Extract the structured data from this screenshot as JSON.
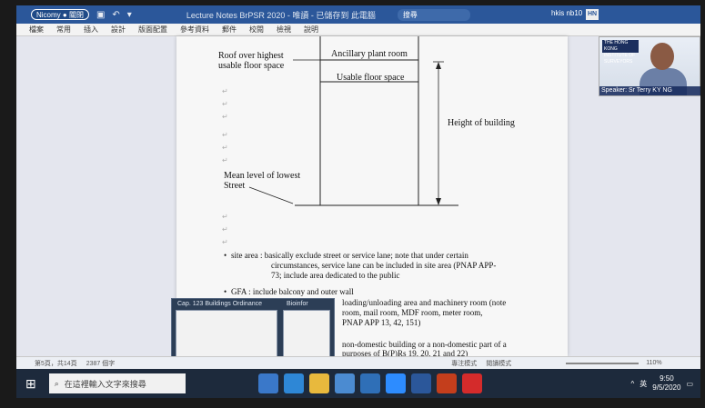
{
  "titlebar": {
    "pill": "Nicomy ● 關閉",
    "title": "Lecture Notes BrPSR 2020 - 唯讀 - 已儲存到 此電腦",
    "search": "搜尋",
    "user": "hkis nb10",
    "avatar": "HN",
    "min": "—",
    "max": "□",
    "close": "✕"
  },
  "ribbon": [
    "檔案",
    "常用",
    "插入",
    "設計",
    "版面配置",
    "參考資料",
    "郵件",
    "校閱",
    "檢視",
    "說明"
  ],
  "diagram": {
    "roof_label_1": "Roof over highest",
    "roof_label_2": "usable floor space",
    "ancillary": "Ancillary plant room",
    "usable": "Usable floor space",
    "height": "Height of building",
    "mean_1": "Mean level of lowest",
    "mean_2": "Street"
  },
  "notes": {
    "site_1": "site area : basically exclude street or service lane; note that under certain",
    "site_2": "circumstances, service lane can be included in site area (PNAP APP-",
    "site_3": "73; include area dedicated to the public",
    "gfa_1": "GFA : include balcony and outer wall",
    "gfa_2": "loading/unloading area and machinery room (note",
    "gfa_3": "room, mail room, MDF room, meter room,",
    "gfa_4": "PNAP APP 13, 42, 151)",
    "nd_1": "non-domestic building or a non-domestic part of a",
    "nd_2": "purposes of B(P)Rs 19, 20, 21 and 22)"
  },
  "video": {
    "logo": "THE HONG KONG INSTITUTE OF SURVEYORS",
    "caption": "Speaker: Sr Terry KY NG"
  },
  "popup": {
    "left_title": "Cap. 123 Buildings Ordinance",
    "right_title": "Bioinfor"
  },
  "statusbar": {
    "page": "第5頁，共14頁",
    "words": "2387 個字",
    "focus": "專注模式",
    "views": "閱讀模式",
    "zoom": "110%"
  },
  "taskbar": {
    "search_placeholder": "在這裡輸入文字來搜尋",
    "lang": "英",
    "time": "9:50",
    "date": "9/5/2020"
  }
}
